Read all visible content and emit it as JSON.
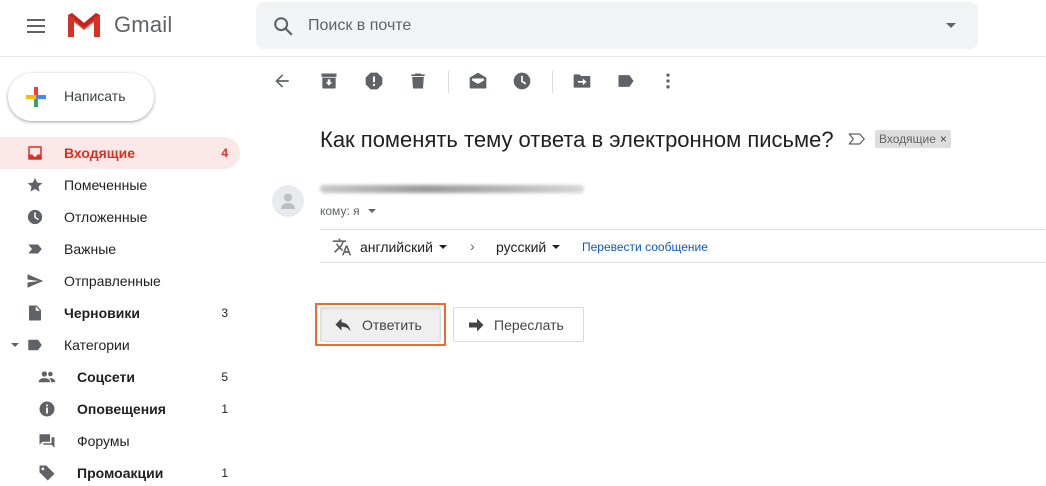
{
  "header": {
    "logo_text": "Gmail",
    "search_placeholder": "Поиск в почте"
  },
  "compose": {
    "label": "Написать"
  },
  "sidebar": {
    "items": [
      {
        "label": "Входящие",
        "count": "4",
        "icon": "inbox-icon"
      },
      {
        "label": "Помеченные",
        "count": "",
        "icon": "star-icon"
      },
      {
        "label": "Отложенные",
        "count": "",
        "icon": "clock-icon"
      },
      {
        "label": "Важные",
        "count": "",
        "icon": "important-icon"
      },
      {
        "label": "Отправленные",
        "count": "",
        "icon": "send-icon"
      },
      {
        "label": "Черновики",
        "count": "3",
        "icon": "draft-icon"
      },
      {
        "label": "Категории",
        "count": "",
        "icon": "label-icon"
      },
      {
        "label": "Соцсети",
        "count": "5",
        "icon": "people-icon"
      },
      {
        "label": "Оповещения",
        "count": "1",
        "icon": "info-icon"
      },
      {
        "label": "Форумы",
        "count": "",
        "icon": "forum-icon"
      },
      {
        "label": "Промоакции",
        "count": "1",
        "icon": "tag-icon"
      }
    ]
  },
  "message": {
    "subject": "Как поменять тему ответа в электронном письме?",
    "label_chip": "Входящие",
    "label_chip_close": "×",
    "to_line": "кому: я"
  },
  "translate": {
    "source_lang": "английский",
    "arrow": "›",
    "target_lang": "русский",
    "action": "Перевести сообщение"
  },
  "actions": {
    "reply_label": "Ответить",
    "forward_label": "Переслать"
  },
  "colors": {
    "accent_red": "#d93025",
    "active_bg": "#fce8e6",
    "highlight_outline": "#ec6b31",
    "link_blue": "#1155cc"
  }
}
